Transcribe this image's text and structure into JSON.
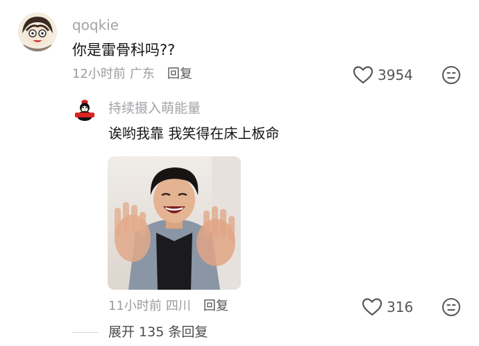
{
  "main_comment": {
    "username": "qoqkie",
    "text": "你是雷骨科吗??",
    "time": "12小时前",
    "location": "广东",
    "reply_label": "回复",
    "likes": "3954",
    "avatar_icon": "cartoon-face-avatar",
    "like_icon": "heart-outline-icon",
    "dislike_icon": "meh-face-icon"
  },
  "reply_comment": {
    "username": "持续摄入萌能量",
    "text": "诶哟我靠 我笑得在床上板命",
    "time": "11小时前",
    "location": "四川",
    "reply_label": "回复",
    "likes": "316",
    "avatar_icon": "penguin-avatar",
    "image": "photo-of-laughing-man-waving-hands"
  },
  "expand": {
    "label": "展开 135 条回复"
  },
  "colors": {
    "muted": "#9b9ba0",
    "text": "#151518",
    "icon": "#55555a"
  }
}
